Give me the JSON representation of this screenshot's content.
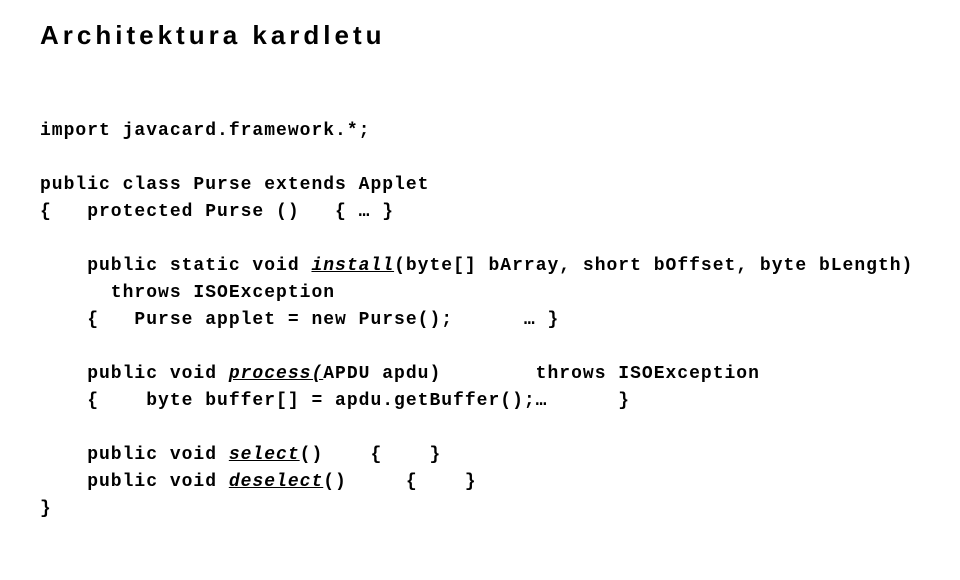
{
  "title": "Architektura kardletu",
  "code": {
    "l1": "import javacard.framework.*;",
    "l2": "public class Purse extends Applet",
    "l3": "{   protected Purse ()   { … }",
    "l4": "    public static void ",
    "l4i": "install",
    "l4b": "(byte[] bArray, short bOffset, byte bLength)",
    "l5": "      throws ISOException",
    "l6": "    {   Purse applet = new Purse();      … }",
    "l7": "    public void ",
    "l7i": "process(",
    "l7b": "APDU apdu)        throws ISOException",
    "l8": "    {    byte buffer[] = apdu.getBuffer();…      }",
    "l9": "    public void ",
    "l9i": "select",
    "l9b": "()    {    }",
    "l10": "    public void ",
    "l10i": "deselect",
    "l10b": "()     {    }",
    "l11": "}"
  }
}
